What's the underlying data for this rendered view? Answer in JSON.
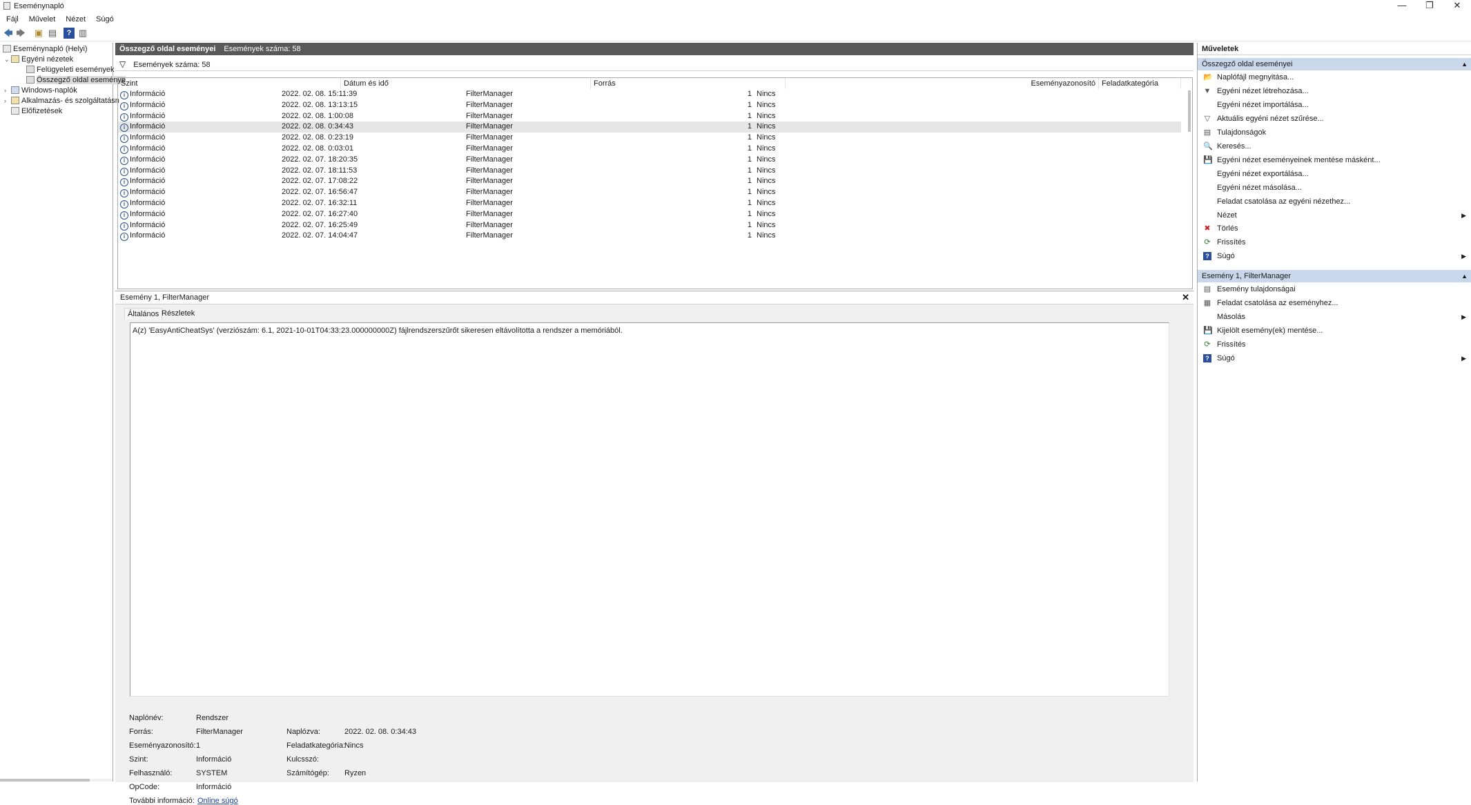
{
  "window": {
    "title": "Eseménynapló",
    "minimize_glyph": "—",
    "restore_glyph": "❐",
    "close_glyph": "✕"
  },
  "menu": [
    "Fájl",
    "Művelet",
    "Nézet",
    "Súgó"
  ],
  "toolbar": {
    "icons": [
      "back-icon",
      "forward-icon",
      "up-folder-icon",
      "show-hide-tree-icon",
      "help-icon",
      "show-hide-action-pane-icon"
    ],
    "glyphs": [
      "🡄",
      "🡆",
      "▣",
      "▤",
      "?",
      "▥"
    ]
  },
  "tree": {
    "root": "Eseménynapló (Helyi)",
    "custom_views": "Egyéni nézetek",
    "admin_events": "Felügyeleti események",
    "summary_page": "Összegző oldal eseménye",
    "windows_logs": "Windows-naplók",
    "app_logs": "Alkalmazás- és szolgáltatásn",
    "subscriptions": "Előfizetések"
  },
  "center": {
    "title": "Összegző oldal eseményei",
    "count_label": "Események száma: 58",
    "filter_text": "Események száma: 58",
    "filter_icon": "▽",
    "columns": [
      "Szint",
      "Dátum és idő",
      "Forrás",
      "Eseményazonosító",
      "Feladatkategória"
    ],
    "rows": [
      {
        "level": "Információ",
        "datetime": "2022. 02. 08. 15:11:39",
        "source": "FilterManager",
        "id": "1",
        "category": "Nincs"
      },
      {
        "level": "Információ",
        "datetime": "2022. 02. 08. 13:13:15",
        "source": "FilterManager",
        "id": "1",
        "category": "Nincs"
      },
      {
        "level": "Információ",
        "datetime": "2022. 02. 08. 1:00:08",
        "source": "FilterManager",
        "id": "1",
        "category": "Nincs"
      },
      {
        "level": "Információ",
        "datetime": "2022. 02. 08. 0:34:43",
        "source": "FilterManager",
        "id": "1",
        "category": "Nincs"
      },
      {
        "level": "Információ",
        "datetime": "2022. 02. 08. 0:23:19",
        "source": "FilterManager",
        "id": "1",
        "category": "Nincs"
      },
      {
        "level": "Információ",
        "datetime": "2022. 02. 08. 0:03:01",
        "source": "FilterManager",
        "id": "1",
        "category": "Nincs"
      },
      {
        "level": "Információ",
        "datetime": "2022. 02. 07. 18:20:35",
        "source": "FilterManager",
        "id": "1",
        "category": "Nincs"
      },
      {
        "level": "Információ",
        "datetime": "2022. 02. 07. 18:11:53",
        "source": "FilterManager",
        "id": "1",
        "category": "Nincs"
      },
      {
        "level": "Információ",
        "datetime": "2022. 02. 07. 17:08:22",
        "source": "FilterManager",
        "id": "1",
        "category": "Nincs"
      },
      {
        "level": "Információ",
        "datetime": "2022. 02. 07. 16:56:47",
        "source": "FilterManager",
        "id": "1",
        "category": "Nincs"
      },
      {
        "level": "Információ",
        "datetime": "2022. 02. 07. 16:32:11",
        "source": "FilterManager",
        "id": "1",
        "category": "Nincs"
      },
      {
        "level": "Információ",
        "datetime": "2022. 02. 07. 16:27:40",
        "source": "FilterManager",
        "id": "1",
        "category": "Nincs"
      },
      {
        "level": "Információ",
        "datetime": "2022. 02. 07. 16:25:49",
        "source": "FilterManager",
        "id": "1",
        "category": "Nincs"
      },
      {
        "level": "Információ",
        "datetime": "2022. 02. 07. 14:04:47",
        "source": "FilterManager",
        "id": "1",
        "category": "Nincs"
      }
    ]
  },
  "detail": {
    "title": "Esemény 1, FilterManager",
    "close_glyph": "✕",
    "tabs": [
      "Általános",
      "Részletek"
    ],
    "message": "A(z) 'EasyAntiCheatSys' (verziószám: 6.1, 2021-10-01T04:33:23.000000000Z) fájlrendszerszűrőt sikeresen eltávolította a rendszer a memóriából.",
    "labels": {
      "log_name": "Naplónév:",
      "source": "Forrás:",
      "event_id": "Eseményazonosító:",
      "level": "Szint:",
      "user": "Felhasználó:",
      "opcode": "OpCode:",
      "more_info": "További információ:",
      "logged": "Naplózva:",
      "task_category": "Feladatkategória:",
      "keywords": "Kulcsszó:",
      "computer": "Számítógép:"
    },
    "values": {
      "log_name": "Rendszer",
      "source": "FilterManager",
      "event_id": "1",
      "level": "Információ",
      "user": "SYSTEM",
      "opcode": "Információ",
      "more_info": "Online súgó",
      "logged": "2022. 02. 08. 0:34:43",
      "task_category": "Nincs",
      "keywords": "",
      "computer": "Ryzen"
    }
  },
  "actions": {
    "title": "Műveletek",
    "section1": "Összegző oldal eseményei",
    "section1_items": [
      {
        "label": "Naplófájl megnyitása...",
        "icon": "open-log-icon",
        "glyph": "📂",
        "submenu": false
      },
      {
        "label": "Egyéni nézet létrehozása...",
        "icon": "create-view-icon",
        "glyph": "▼",
        "submenu": false
      },
      {
        "label": "Egyéni nézet importálása...",
        "icon": "",
        "glyph": "",
        "submenu": false
      },
      {
        "label": "Aktuális egyéni nézet szűrése...",
        "icon": "filter-icon",
        "glyph": "▽",
        "submenu": false
      },
      {
        "label": "Tulajdonságok",
        "icon": "properties-icon",
        "glyph": "▤",
        "submenu": false
      },
      {
        "label": "Keresés...",
        "icon": "find-icon",
        "glyph": "🔍",
        "submenu": false
      },
      {
        "label": "Egyéni nézet eseményeinek mentése másként...",
        "icon": "save-icon",
        "glyph": "💾",
        "submenu": false
      },
      {
        "label": "Egyéni nézet exportálása...",
        "icon": "",
        "glyph": "",
        "submenu": false
      },
      {
        "label": "Egyéni nézet másolása...",
        "icon": "",
        "glyph": "",
        "submenu": false
      },
      {
        "label": "Feladat csatolása az egyéni nézethez...",
        "icon": "",
        "glyph": "",
        "submenu": false
      },
      {
        "label": "Nézet",
        "icon": "",
        "glyph": "",
        "submenu": true
      },
      {
        "label": "Törlés",
        "icon": "delete-icon",
        "glyph": "✖",
        "submenu": false
      },
      {
        "label": "Frissítés",
        "icon": "refresh-icon",
        "glyph": "⟳",
        "submenu": false
      },
      {
        "label": "Súgó",
        "icon": "help-icon",
        "glyph": "?",
        "submenu": true
      }
    ],
    "section2": "Esemény 1, FilterManager",
    "section2_items": [
      {
        "label": "Esemény tulajdonságai",
        "icon": "event-properties-icon",
        "glyph": "▤",
        "submenu": false
      },
      {
        "label": "Feladat csatolása az eseményhez...",
        "icon": "attach-task-icon",
        "glyph": "▦",
        "submenu": false
      },
      {
        "label": "Másolás",
        "icon": "",
        "glyph": "",
        "submenu": true
      },
      {
        "label": "Kijelölt esemény(ek) mentése...",
        "icon": "save-icon",
        "glyph": "💾",
        "submenu": false
      },
      {
        "label": "Frissítés",
        "icon": "refresh-icon",
        "glyph": "⟳",
        "submenu": false
      },
      {
        "label": "Súgó",
        "icon": "help-icon",
        "glyph": "?",
        "submenu": true
      }
    ],
    "collapse_glyph": "▲",
    "submenu_glyph": "▶"
  },
  "colors": {
    "header_bg": "#595959",
    "section_bg": "#c8d8ea",
    "selected_row": "#e6e6e6",
    "link": "#1a3ea8",
    "delete_icon": "#c62828",
    "refresh_icon": "#2e7d32",
    "help_icon": "#2b4f9e"
  }
}
